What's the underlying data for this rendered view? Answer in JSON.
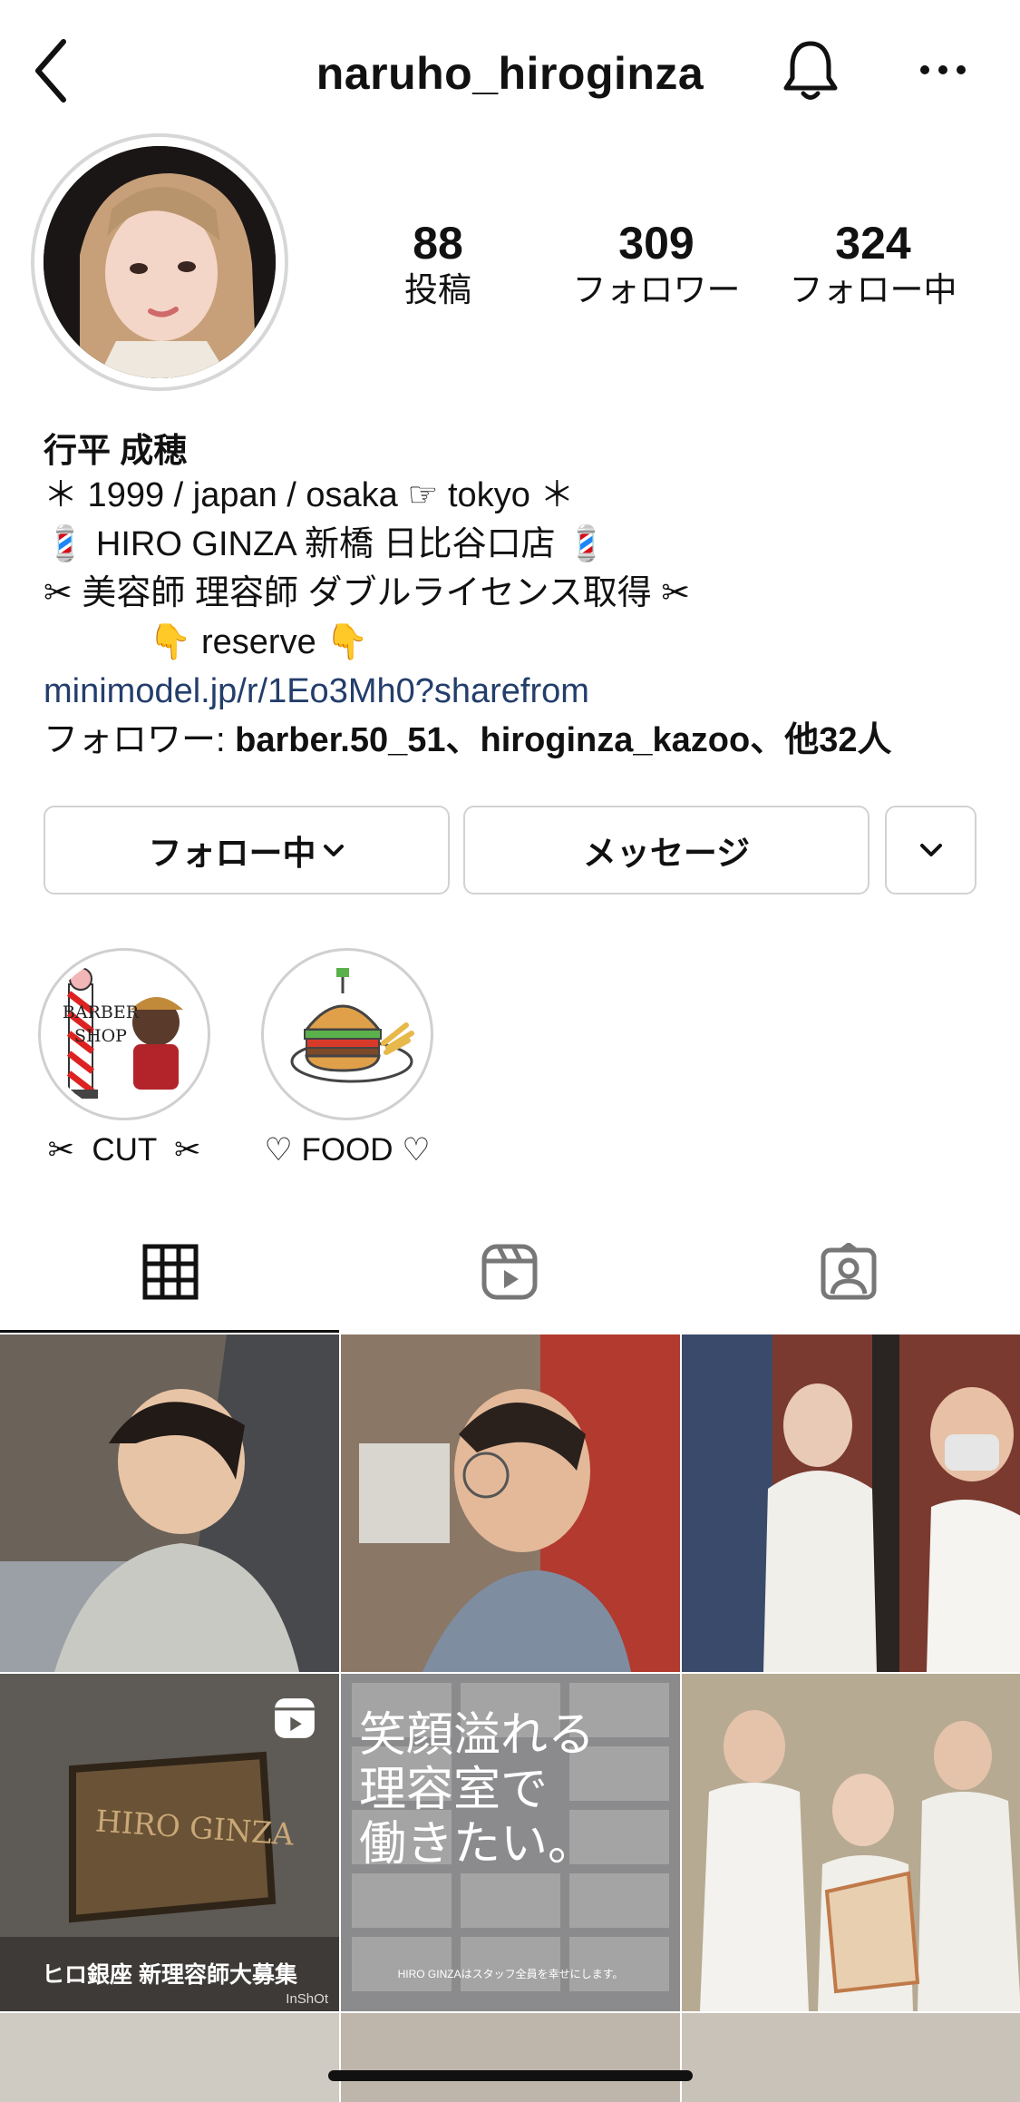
{
  "header": {
    "username": "naruho_hiroginza",
    "back_icon": "chevron-left-icon",
    "notification_icon": "bell-icon",
    "more_icon": "more-horizontal-icon"
  },
  "profile": {
    "stats": [
      {
        "value": "88",
        "label": "投稿"
      },
      {
        "value": "309",
        "label": "フォロワー"
      },
      {
        "value": "324",
        "label": "フォロー中"
      }
    ],
    "display_name": "行平 成穂",
    "bio_lines": [
      "＊ 1999 / japan / osaka ☞ tokyo ＊",
      "💈 HIRO GINZA 新橋 日比谷口店 💈",
      "✂ 美容師 理容師 ダブルライセンス取得 ✂",
      "           👇 reserve 👇"
    ],
    "link": "minimodel.jp/r/1Eo3Mh0?sharefrom",
    "followed_by_prefix": "フォロワー: ",
    "followed_by_names": "barber.50_51、hiroginza_kazoo、他32人"
  },
  "actions": {
    "following_label": "フォロー中",
    "message_label": "メッセージ",
    "chevron_icon": "chevron-down-icon"
  },
  "highlights": [
    {
      "label": "✂  CUT  ✂",
      "image_text": "BARBER\nSHOP"
    },
    {
      "label": "♡ FOOD ♡"
    }
  ],
  "tabs": [
    {
      "name": "grid",
      "icon": "grid-icon",
      "active": true
    },
    {
      "name": "reels",
      "icon": "reels-icon",
      "active": false
    },
    {
      "name": "tagged",
      "icon": "tagged-person-icon",
      "active": false
    }
  ],
  "posts": [
    {
      "type": "photo"
    },
    {
      "type": "photo"
    },
    {
      "type": "photo"
    },
    {
      "type": "reel",
      "sign_text": "HIRO GINZA",
      "caption": "ヒロ銀座 新理容師大募集",
      "watermark": "InShOt"
    },
    {
      "type": "photo",
      "headline": "笑顔溢れる\n理容室で\n働きたい。",
      "subtext": "HIRO GINZAはスタッフ全員を幸せにします。"
    },
    {
      "type": "photo"
    }
  ],
  "colors": {
    "link": "#233e6b",
    "border": "#d2d2d2",
    "text": "#111111"
  }
}
